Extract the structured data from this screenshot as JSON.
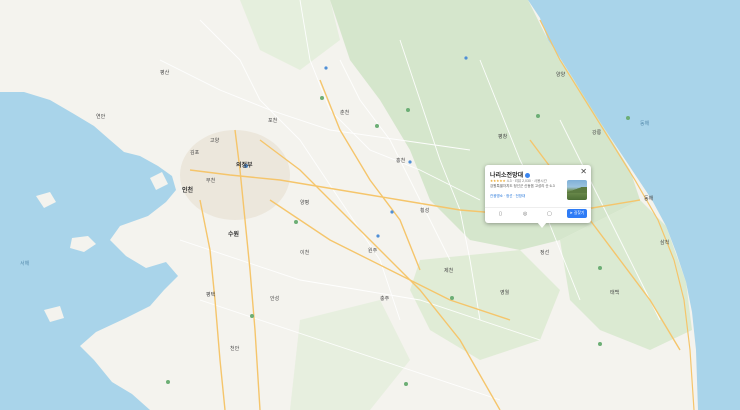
{
  "map": {
    "colors": {
      "sea": "#a9d4ea",
      "land": "#f4f3ee",
      "mountain": "#cfe3c6",
      "road_major": "#f5c56b",
      "road_minor": "#ffffff",
      "urban": "#ece7dc"
    },
    "places": [
      {
        "id": "pyeongsan",
        "label": "평산"
      },
      {
        "id": "yeonan",
        "label": "연안"
      },
      {
        "id": "incheon",
        "label": "인천"
      },
      {
        "id": "bucheon",
        "label": "부천"
      },
      {
        "id": "suwon",
        "label": "수원"
      },
      {
        "id": "gimpo",
        "label": "김포"
      },
      {
        "id": "goyang",
        "label": "고양"
      },
      {
        "id": "uijeongbu",
        "label": "의정부"
      },
      {
        "id": "pocheon",
        "label": "포천"
      },
      {
        "id": "yangpyeong",
        "label": "양평"
      },
      {
        "id": "wonju",
        "label": "원주"
      },
      {
        "id": "chuncheon",
        "label": "춘천"
      },
      {
        "id": "hongcheon",
        "label": "홍천"
      },
      {
        "id": "gangneung",
        "label": "강릉"
      },
      {
        "id": "yangyang",
        "label": "양양"
      },
      {
        "id": "donghae",
        "label": "동해"
      },
      {
        "id": "samcheok",
        "label": "삼척"
      },
      {
        "id": "jecheon",
        "label": "제천"
      },
      {
        "id": "chungju",
        "label": "충주"
      },
      {
        "id": "anseong",
        "label": "안성"
      },
      {
        "id": "pyeongtaek",
        "label": "평택"
      },
      {
        "id": "cheonan",
        "label": "천안"
      },
      {
        "id": "icheon",
        "label": "이천"
      },
      {
        "id": "yeongwol",
        "label": "영월"
      },
      {
        "id": "taebaek",
        "label": "태백"
      },
      {
        "id": "jeongseon",
        "label": "정선"
      },
      {
        "id": "pyeongchang",
        "label": "평창"
      },
      {
        "id": "hoengseong",
        "label": "횡성"
      }
    ],
    "sea_labels": [
      {
        "id": "east-sea",
        "label": "동해"
      },
      {
        "id": "west-sea",
        "label": "서해"
      }
    ]
  },
  "place_card": {
    "title": "나리소전망대",
    "rating_stars": "★★★★★",
    "rating_text": "4.3 · 리뷰 2,030 · 사용시간",
    "description": "강원특별자치도 정선군 신동읍 고성리 산 6-3",
    "tags": "관광명소 · 정선 · 전망대",
    "icons": [
      "bookmark-icon",
      "location-pin-icon",
      "share-icon"
    ],
    "icon_glyphs": [
      "▯",
      "◎",
      "▢"
    ],
    "close_glyph": "✕",
    "directions_label": "➤ 길찾기"
  }
}
